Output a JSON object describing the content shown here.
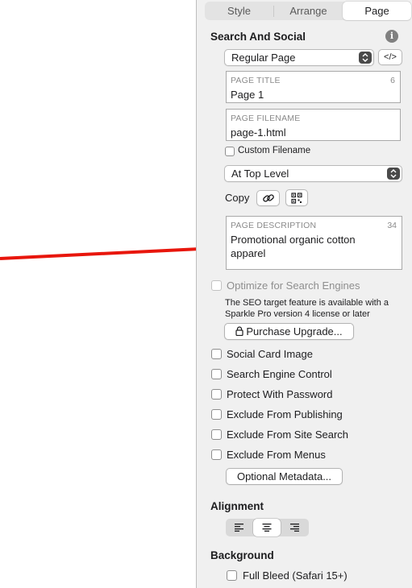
{
  "tabs": [
    {
      "label": "Style",
      "active": false
    },
    {
      "label": "Arrange",
      "active": false
    },
    {
      "label": "Page",
      "active": true
    }
  ],
  "search_social": {
    "title": "Search And Social",
    "info_icon": "info-icon",
    "page_type_select": {
      "value": "Regular Page"
    },
    "code_button": {
      "icon": "code-icon",
      "label": "</>"
    },
    "page_title": {
      "label": "PAGE TITLE",
      "count": "6",
      "value": "Page 1"
    },
    "page_filename": {
      "label": "PAGE FILENAME",
      "value": "page-1.html"
    },
    "custom_filename": {
      "label": "Custom Filename",
      "checked": false
    },
    "level_select": {
      "value": "At Top Level"
    },
    "copy": {
      "label": "Copy",
      "link_icon": "link-icon",
      "qr_icon": "qr-code-icon"
    },
    "page_description": {
      "label": "PAGE DESCRIPTION",
      "count": "34",
      "line1": "Promotional organic cotton",
      "line2": "apparel"
    },
    "optimize": {
      "label": "Optimize for Search Engines",
      "checked": false,
      "disabled": true
    },
    "seo_note_line1": "The SEO target feature is available with a",
    "seo_note_line2": "Sparkle Pro version 4 license or later",
    "purchase_button": {
      "icon": "lock-icon",
      "label": "Purchase Upgrade..."
    },
    "options": [
      {
        "label": "Social Card Image",
        "checked": false
      },
      {
        "label": "Search Engine Control",
        "checked": false
      },
      {
        "label": "Protect With Password",
        "checked": false
      },
      {
        "label": "Exclude From Publishing",
        "checked": false
      },
      {
        "label": "Exclude From Site Search",
        "checked": false
      },
      {
        "label": "Exclude From Menus",
        "checked": false
      }
    ],
    "metadata_button": {
      "label": "Optional Metadata..."
    }
  },
  "alignment": {
    "title": "Alignment",
    "options": [
      {
        "icon": "align-left-icon",
        "active": false
      },
      {
        "icon": "align-center-icon",
        "active": true
      },
      {
        "icon": "align-right-icon",
        "active": false
      }
    ]
  },
  "background": {
    "title": "Background",
    "full_bleed": {
      "label": "Full Bleed (Safari 15+)",
      "checked": false
    }
  },
  "annotation": {
    "arrow_color": "#e8160c"
  },
  "colors": {
    "panel": "#f0f0f0",
    "canvas": "#ffffff"
  }
}
